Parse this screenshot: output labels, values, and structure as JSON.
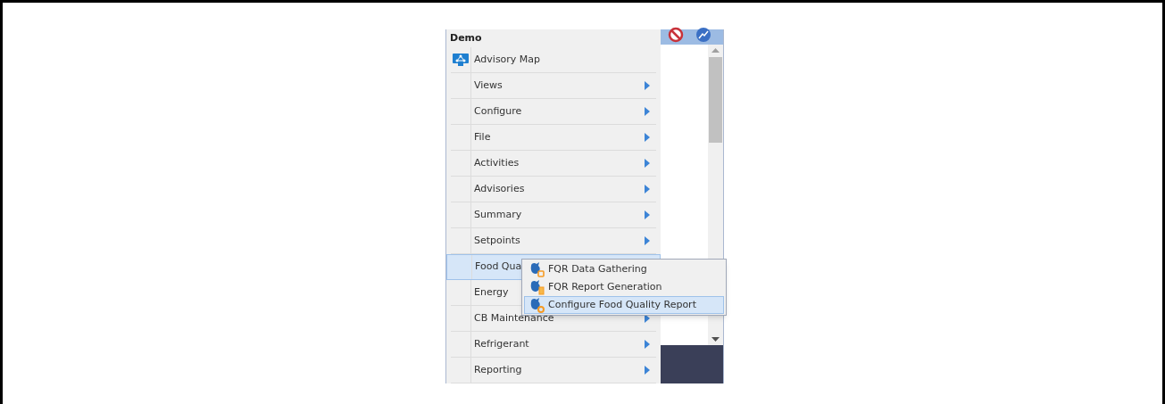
{
  "menu": {
    "title": "Demo",
    "items": [
      {
        "label": "Advisory Map",
        "kind": "link",
        "selected": false,
        "arrow": false
      },
      {
        "label": "Views",
        "kind": "submenu",
        "selected": false,
        "arrow": true
      },
      {
        "label": "Configure",
        "kind": "submenu",
        "selected": false,
        "arrow": true
      },
      {
        "label": "File",
        "kind": "submenu",
        "selected": false,
        "arrow": true
      },
      {
        "label": "Activities",
        "kind": "submenu",
        "selected": false,
        "arrow": true
      },
      {
        "label": "Advisories",
        "kind": "submenu",
        "selected": false,
        "arrow": true
      },
      {
        "label": "Summary",
        "kind": "submenu",
        "selected": false,
        "arrow": true
      },
      {
        "label": "Setpoints",
        "kind": "submenu",
        "selected": false,
        "arrow": true
      },
      {
        "label": "Food Qua",
        "kind": "submenu",
        "selected": true,
        "arrow": false
      },
      {
        "label": "Energy",
        "kind": "submenu",
        "selected": false,
        "arrow": false
      },
      {
        "label": "CB Maintenance",
        "kind": "submenu",
        "selected": false,
        "arrow": true
      },
      {
        "label": "Refrigerant",
        "kind": "submenu",
        "selected": false,
        "arrow": true
      },
      {
        "label": "Reporting",
        "kind": "submenu",
        "selected": false,
        "arrow": true
      }
    ]
  },
  "submenu": {
    "items": [
      {
        "label": "FQR Data Gathering",
        "kind": "gather",
        "selected": false
      },
      {
        "label": "FQR Report Generation",
        "kind": "report",
        "selected": false
      },
      {
        "label": "Configure Food Quality Report",
        "kind": "configure",
        "selected": true
      }
    ]
  }
}
